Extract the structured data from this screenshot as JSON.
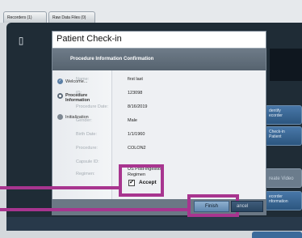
{
  "tabs": [
    {
      "label": "Recorders (1)"
    },
    {
      "label": "Raw Data Files (0)"
    }
  ],
  "dialog": {
    "title": "Patient Check-in",
    "banner": "Procedure Information Confirmation"
  },
  "steps": [
    {
      "label": "Welcome...",
      "state": "done"
    },
    {
      "label_line1": "Procedure",
      "label_line2": "Information",
      "state": "current"
    },
    {
      "label": "Initialization",
      "state": "pending"
    }
  ],
  "patient": {
    "name_label": "Name:",
    "name": "first last",
    "id_label": "ID:",
    "id": "123098",
    "date_label": "Procedure Date:",
    "date": "8/16/2019",
    "gender_label": "Gender:",
    "gender": "Male",
    "birth_label": "Birth Date:",
    "birth": "1/1/1960",
    "procedure_label": "Procedure:",
    "procedure": "COLON2",
    "capsule_label": "Capsule ID:",
    "capsule": "",
    "regimen_label": "Regimen:",
    "regimen_line1": "US Post-ingestion",
    "regimen_line2": "Regimen"
  },
  "accept": {
    "label": "Accept",
    "checked": true,
    "mark": "✔"
  },
  "buttons": {
    "finish": "Finish",
    "cancel": "Cancel",
    "cancel_visible": "ancel"
  },
  "side_buttons": [
    {
      "line1": "Identify",
      "line2": "Recorder",
      "visible1": "dentify",
      "visible2": "ecorder"
    },
    {
      "line1": "Check-in",
      "line2": "Patient",
      "visible1": "Check-in",
      "visible2": "Patient"
    },
    {
      "label": "Create Video",
      "visible": "reate Video"
    },
    {
      "line1": "Recorder",
      "line2": "Information",
      "visible1": "ecorder",
      "visible2": "nformation"
    }
  ],
  "colors": {
    "callout": "#a8358f",
    "banner": "#5f6c78",
    "finish": "#7aa0c4"
  }
}
